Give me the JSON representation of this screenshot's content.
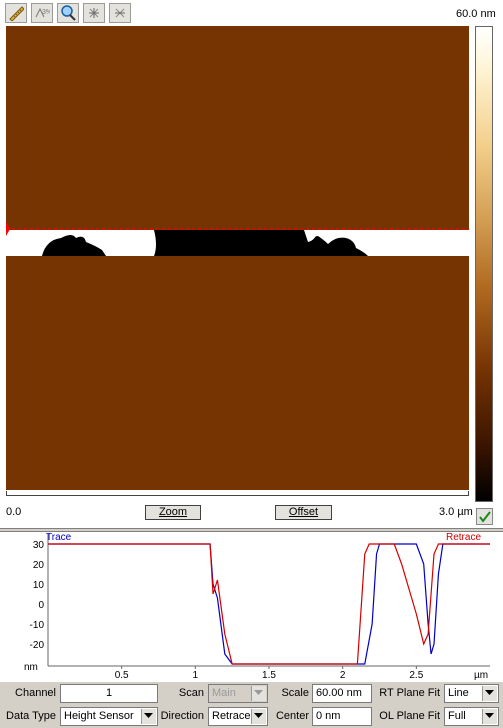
{
  "toolbar": {
    "tools": [
      {
        "name": "ruler-icon"
      },
      {
        "name": "marker-icon"
      },
      {
        "name": "magnifier-icon"
      },
      {
        "name": "zoom-in-icon"
      },
      {
        "name": "zoom-out-icon"
      }
    ]
  },
  "image": {
    "scale_max": "60.0 nm",
    "x_min": "0.0",
    "x_max": "3.0 µm",
    "zoom_label": "Zoom",
    "offset_label": "Offset",
    "colors": {
      "substrate": "#773403",
      "high": "#ffffff",
      "low": "#000000",
      "scanline": "#ff0000"
    }
  },
  "profile": {
    "trace_label": "Trace",
    "retrace_label": "Retrace",
    "y_unit": "nm",
    "x_unit": "µm",
    "y_ticks": [
      "30",
      "20",
      "10",
      "0",
      "-10",
      "-20"
    ],
    "x_ticks": [
      "0.5",
      "1",
      "1.5",
      "2",
      "2.5"
    ],
    "colors": {
      "trace": "#0000c8",
      "retrace": "#d40000"
    }
  },
  "chart_data": {
    "type": "line",
    "xlabel": "µm",
    "ylabel": "nm",
    "xlim": [
      0,
      3.0
    ],
    "ylim": [
      -30,
      30
    ],
    "series": [
      {
        "name": "Trace",
        "points": [
          [
            0,
            30
          ],
          [
            1.1,
            30
          ],
          [
            1.12,
            10
          ],
          [
            1.15,
            3
          ],
          [
            1.2,
            -25
          ],
          [
            1.25,
            -30
          ],
          [
            1.3,
            -30
          ],
          [
            2.0,
            -30
          ],
          [
            2.15,
            -30
          ],
          [
            2.2,
            -10
          ],
          [
            2.23,
            25
          ],
          [
            2.25,
            30
          ],
          [
            2.5,
            30
          ],
          [
            2.55,
            20
          ],
          [
            2.58,
            -10
          ],
          [
            2.6,
            -25
          ],
          [
            2.62,
            -20
          ],
          [
            2.65,
            15
          ],
          [
            2.68,
            30
          ],
          [
            3.0,
            30
          ]
        ]
      },
      {
        "name": "Retrace",
        "points": [
          [
            0,
            30
          ],
          [
            1.1,
            30
          ],
          [
            1.12,
            5
          ],
          [
            1.15,
            12
          ],
          [
            1.2,
            -15
          ],
          [
            1.25,
            -30
          ],
          [
            1.3,
            -30
          ],
          [
            2.0,
            -30
          ],
          [
            2.1,
            -30
          ],
          [
            2.15,
            25
          ],
          [
            2.18,
            30
          ],
          [
            2.35,
            30
          ],
          [
            2.4,
            20
          ],
          [
            2.5,
            -5
          ],
          [
            2.55,
            -20
          ],
          [
            2.58,
            -15
          ],
          [
            2.62,
            25
          ],
          [
            2.65,
            30
          ],
          [
            3.0,
            30
          ]
        ]
      }
    ]
  },
  "controls": {
    "channel_label": "Channel",
    "channel_value": "1",
    "data_type_label": "Data Type",
    "data_type_value": "Height Sensor",
    "scan_label": "Scan",
    "scan_value": "Main",
    "direction_label": "Direction",
    "direction_value": "Retrace",
    "scale_label": "Scale",
    "scale_value": "60.00 nm",
    "center_label": "Center",
    "center_value": "0 nm",
    "rt_plane_fit_label": "RT Plane Fit",
    "rt_plane_fit_value": "Line",
    "ol_plane_fit_label": "OL Plane Fit",
    "ol_plane_fit_value": "Full"
  }
}
